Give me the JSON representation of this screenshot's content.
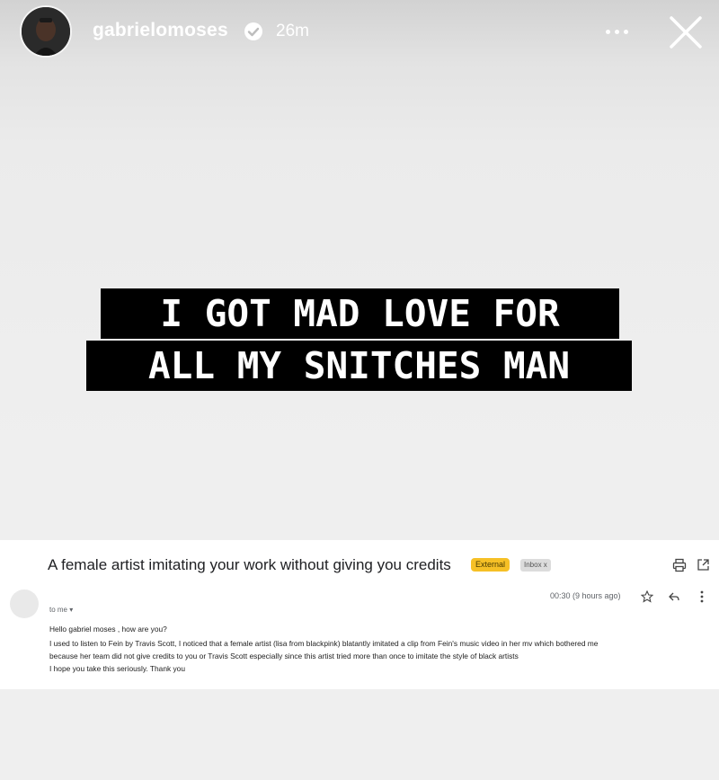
{
  "story": {
    "username": "gabrielomoses",
    "time_ago": "26m",
    "caption_lines": [
      "I GOT MAD LOVE FOR",
      "ALL MY SNITCHES MAN"
    ]
  },
  "email": {
    "subject": "A female artist imitating your work without giving you credits",
    "labels": {
      "external": "External",
      "inbox": "Inbox x"
    },
    "datetime": "00:30 (9 hours ago)",
    "to": "to me ▾",
    "body": [
      "Hello gabriel moses , how are you?",
      "I used to listen to Fein by Travis Scott, I noticed that a female artist (lisa from blackpink) blatantly imitated a clip from Fein's music video in her mv which bothered me",
      "because her team did not give credits to you or Travis Scott especially since this artist tried more than once to imitate the style of black artists",
      "I hope you take this seriously. Thank you"
    ]
  },
  "colors": {
    "verified": "#3897f0",
    "external_tag": "#f6c026",
    "caption_bg": "#000000"
  },
  "icons": [
    "verified-badge-icon",
    "more-options-icon",
    "close-icon",
    "print-icon",
    "open-new-window-icon",
    "star-icon",
    "reply-icon",
    "kebab-menu-icon"
  ]
}
